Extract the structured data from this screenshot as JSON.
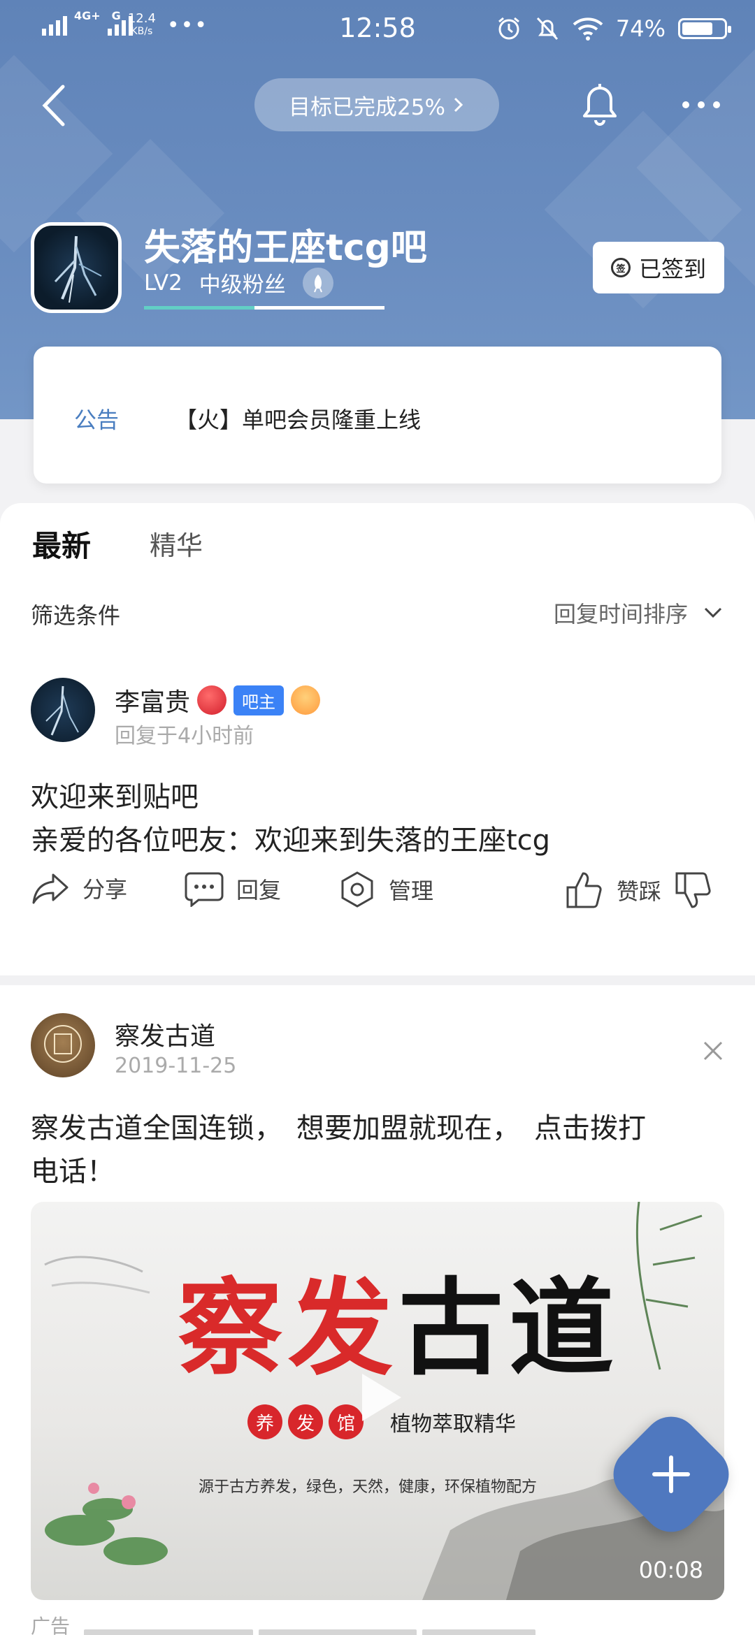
{
  "status_bar": {
    "network": "4G+",
    "network2": "G",
    "speed_value": "12.4",
    "speed_unit": "KB/s",
    "time": "12:58",
    "battery": "74%",
    "battery_level": 0.74
  },
  "nav": {
    "goal_label": "目标已完成25%"
  },
  "forum": {
    "name": "失落的王座tcg吧",
    "level": "LV2",
    "rank": "中级粉丝",
    "level_progress": 0.46,
    "signed_label": "已签到",
    "sign_icon_text": "签"
  },
  "notice": {
    "tag": "公告",
    "text": "【火】单吧会员隆重上线"
  },
  "tabs": {
    "latest": "最新",
    "featured": "精华"
  },
  "filter": {
    "label": "筛选条件",
    "sort": "回复时间排序"
  },
  "post1": {
    "author": "李富贵",
    "badge": "吧主",
    "meta": "回复于4小时前",
    "line1": "欢迎来到贴吧",
    "line2": "亲爱的各位吧友：欢迎来到失落的王座tcg"
  },
  "actions": {
    "share": "分享",
    "reply": "回复",
    "manage": "管理",
    "vote": "赞踩"
  },
  "post2": {
    "author": "察发古道",
    "date": "2019-11-25",
    "line1": "察发古道全国连锁，　想要加盟就现在，　点击拨打",
    "line2": "电话！",
    "video": {
      "title_chars": [
        "察",
        "发",
        "古",
        "道"
      ],
      "chips": [
        "养",
        "发",
        "馆"
      ],
      "subtitle": "植物萃取精华",
      "tagline": "源于古方养发，绿色，天然，健康，环保植物配方",
      "duration": "00:08"
    }
  },
  "ad": {
    "label": "广告"
  },
  "colors": {
    "header": "#6a8dc0",
    "accent": "#4a7ec0",
    "owner_badge": "#3b82f6",
    "progress": "#62cfc5"
  }
}
